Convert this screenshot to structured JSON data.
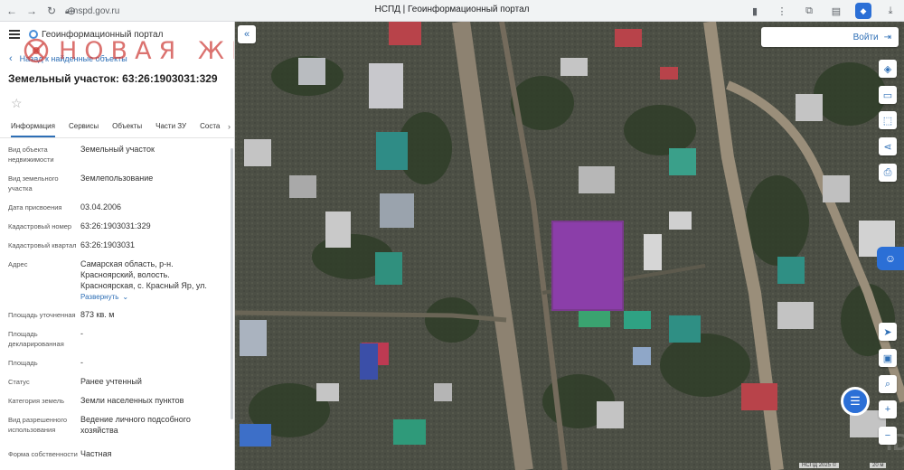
{
  "browser": {
    "url": "nspd.gov.ru",
    "tab_title": "НСПД | Геоинформационный портал",
    "back_icon": "arrow-left-icon",
    "forward_icon": "arrow-right-icon",
    "reload_icon": "reload-icon"
  },
  "panel": {
    "portal_title": "Геоинформационный портал",
    "watermark_text": "НОВАЯ ЖИЗНЬ",
    "back_link": "Назад к найденные объекты",
    "parcel_title": "Земельный участок: 63:26:1903031:329",
    "tabs": [
      "Информация",
      "Сервисы",
      "Объекты",
      "Части ЗУ",
      "Соста"
    ],
    "attributes": [
      {
        "label": "Вид объекта недвижимости",
        "value": "Земельный участок"
      },
      {
        "label": "Вид земельного участка",
        "value": "Землепользование"
      },
      {
        "label": "Дата присвоения",
        "value": "03.04.2006"
      },
      {
        "label": "Кадастровый номер",
        "value": "63:26:1903031:329"
      },
      {
        "label": "Кадастровый квартал",
        "value": "63:26:1903031"
      },
      {
        "label": "Адрес",
        "value": "Самарская область, р-н. Красноярский, волость. Красноярская, с. Красный Яр, ул."
      },
      {
        "label": "Площадь уточненная",
        "value": "873 кв. м"
      },
      {
        "label": "Площадь декларированная",
        "value": "-"
      },
      {
        "label": "Площадь",
        "value": "-"
      },
      {
        "label": "Статус",
        "value": "Ранее учтенный"
      },
      {
        "label": "Категория земель",
        "value": "Земли населенных пунктов"
      },
      {
        "label": "Вид разрешенного использования",
        "value": "Ведение личного подсобного хозяйства"
      },
      {
        "label": "Форма собственности",
        "value": "Частная"
      }
    ],
    "expand_label": "Развернуть"
  },
  "map": {
    "login_label": "Войти",
    "attribution": "НСПД 2025 ©",
    "scale": "20 м",
    "id_watermark": "ID",
    "parcel_color": "#8e3fae",
    "tools": [
      "layers-icon",
      "ruler-icon",
      "select-area-icon",
      "share-icon",
      "print-icon"
    ],
    "nav_tools": [
      "geolocation-icon",
      "minimap-icon",
      "search-map-icon",
      "zoom-in-icon",
      "zoom-out-icon"
    ]
  }
}
